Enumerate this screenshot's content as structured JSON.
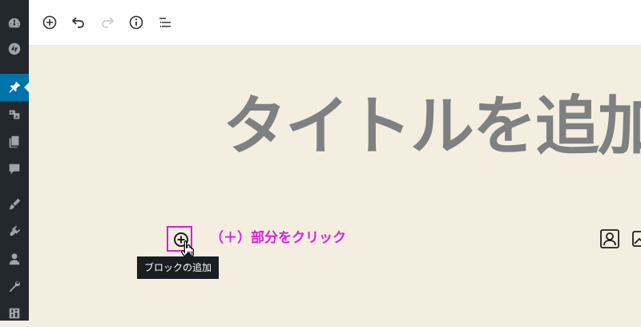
{
  "sidebar": {
    "items": [
      {
        "icon": "dashboard-icon"
      },
      {
        "icon": "jetpack-icon"
      },
      {
        "icon": "posts-pin-icon",
        "active": true
      },
      {
        "icon": "media-icon"
      },
      {
        "icon": "pages-icon"
      },
      {
        "icon": "comments-icon"
      },
      {
        "icon": "appearance-brush-icon"
      },
      {
        "icon": "plugins-icon"
      },
      {
        "icon": "users-icon"
      },
      {
        "icon": "tools-wrench-icon"
      },
      {
        "icon": "settings-icon"
      }
    ],
    "background": "#23282d",
    "active_color": "#0073aa"
  },
  "toolbar": {
    "buttons": [
      {
        "icon": "add-block-icon"
      },
      {
        "icon": "undo-icon"
      },
      {
        "icon": "redo-icon",
        "disabled": true
      },
      {
        "icon": "info-icon"
      },
      {
        "icon": "block-navigation-icon"
      }
    ]
  },
  "editor": {
    "title_placeholder": "タイトルを追加",
    "background": "#f3eee0"
  },
  "inserter": {
    "icon": "plus-circle-icon",
    "tooltip": "ブロックの追加",
    "highlight_color": "#e415e4"
  },
  "annotation": {
    "text": "（＋）部分をクリック",
    "color": "#de1fde"
  },
  "side_icons": [
    {
      "icon": "image-portrait-icon"
    },
    {
      "icon": "gallery-icon"
    }
  ]
}
